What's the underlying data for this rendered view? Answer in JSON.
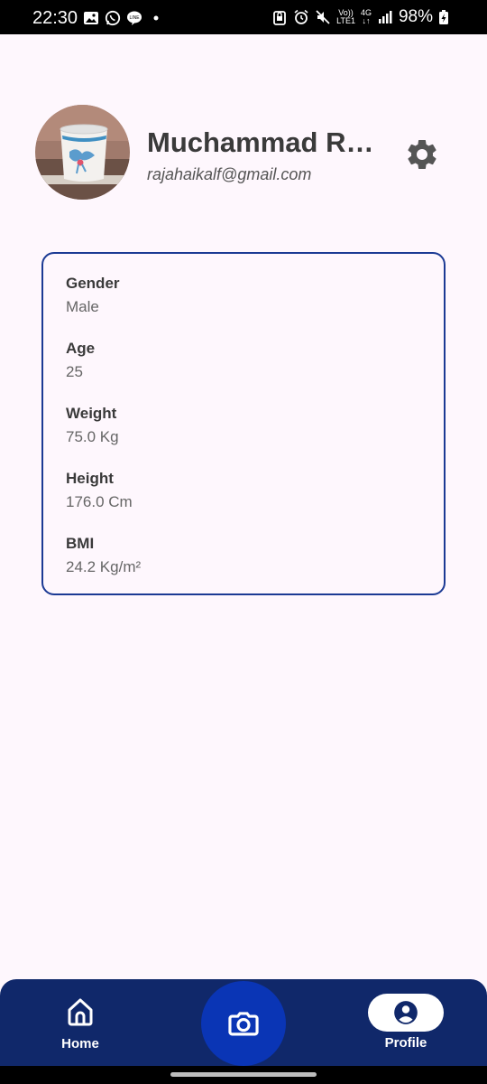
{
  "status_bar": {
    "time": "22:30",
    "battery": "98%",
    "network_top": "Vo))",
    "network_bottom": "LTE1",
    "network_type": "4G",
    "left_icons": [
      "gallery-icon",
      "whatsapp-icon",
      "line-icon",
      "dot-icon"
    ],
    "right_icons": [
      "vpn-lock-icon",
      "alarm-icon",
      "mute-icon",
      "signal-icon",
      "battery-charging-icon"
    ]
  },
  "profile": {
    "name": "Muchammad Ra...",
    "email": "rajahaikalf@gmail.com"
  },
  "info": [
    {
      "label": "Gender",
      "value": "Male"
    },
    {
      "label": "Age",
      "value": "25"
    },
    {
      "label": "Weight",
      "value": "75.0 Kg"
    },
    {
      "label": "Height",
      "value": "176.0 Cm"
    },
    {
      "label": "BMI",
      "value": "24.2 Kg/m²"
    }
  ],
  "nav": {
    "home_label": "Home",
    "profile_label": "Profile",
    "active": "profile"
  },
  "colors": {
    "background": "#fef7fd",
    "card_border": "#1b3a94",
    "nav_background": "#10286a",
    "fab": "#0a35b5"
  }
}
